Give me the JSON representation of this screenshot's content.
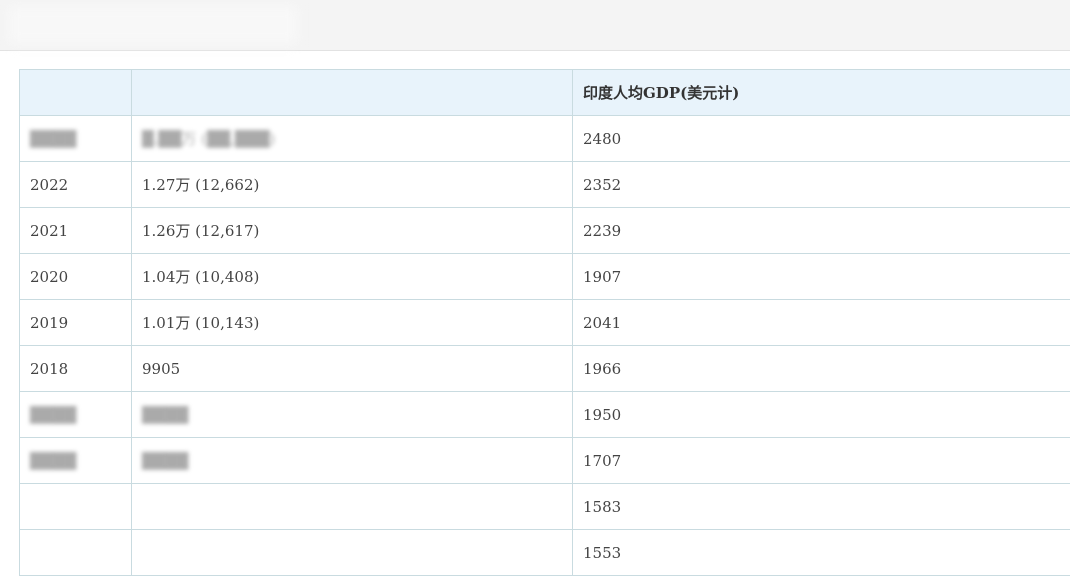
{
  "table": {
    "headers": [
      "",
      "",
      "印度人均GDP(美元计)"
    ],
    "rows": [
      {
        "year": "",
        "cny": "",
        "usd": "2480"
      },
      {
        "year": "2022",
        "cny": "1.27万 (12,662)",
        "usd": "2352"
      },
      {
        "year": "2021",
        "cny": "1.26万 (12,617)",
        "usd": "2239"
      },
      {
        "year": "2020",
        "cny": "1.04万 (10,408)",
        "usd": "1907"
      },
      {
        "year": "2019",
        "cny": "1.01万 (10,143)",
        "usd": "2041"
      },
      {
        "year": "2018",
        "cny": "9905",
        "usd": "1966"
      },
      {
        "year": "",
        "cny": "",
        "usd": "1950"
      },
      {
        "year": "",
        "cny": "",
        "usd": "1707"
      },
      {
        "year": "",
        "cny": "",
        "usd": "1583"
      },
      {
        "year": "",
        "cny": "",
        "usd": "1553"
      }
    ]
  }
}
